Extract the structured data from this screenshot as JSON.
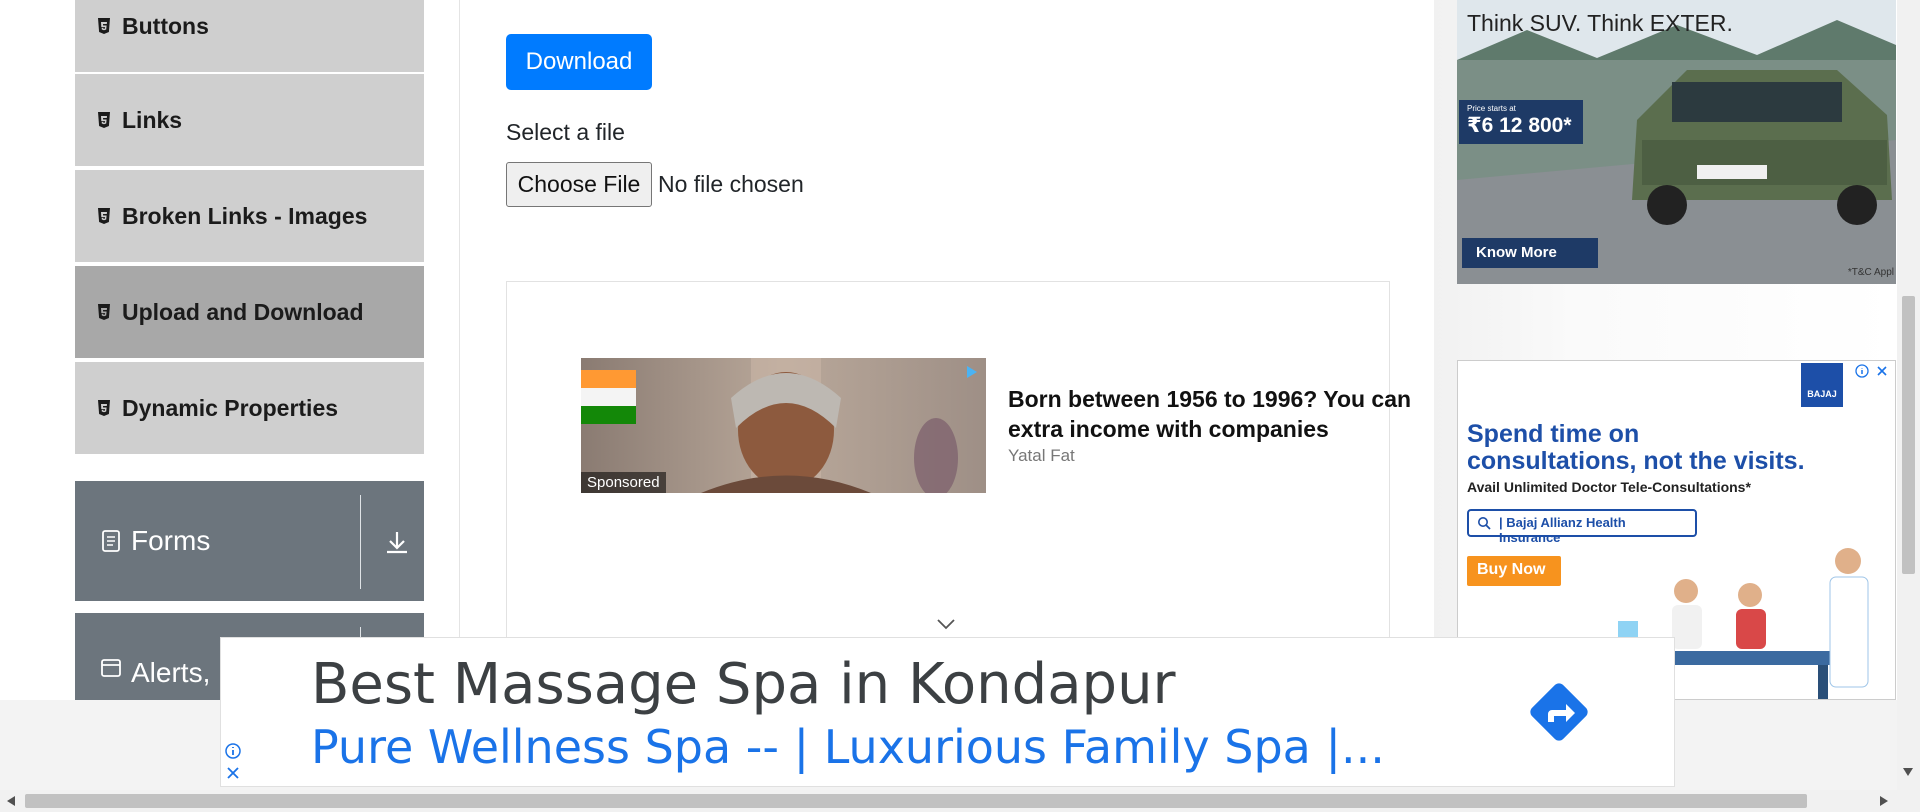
{
  "sidebar": {
    "items": [
      {
        "label": "Buttons",
        "icon": "html5-icon"
      },
      {
        "label": "Links",
        "icon": "html5-icon"
      },
      {
        "label": "Broken Links - Images",
        "icon": "html5-icon"
      },
      {
        "label": "Upload and Download",
        "icon": "html5-icon",
        "active": true
      },
      {
        "label": "Dynamic Properties",
        "icon": "html5-icon"
      }
    ],
    "groups": [
      {
        "label": "Forms",
        "icon": "form-icon"
      },
      {
        "label": "Alerts,",
        "icon": "window-icon"
      }
    ]
  },
  "main": {
    "download_label": "Download",
    "select_label": "Select a file",
    "choose_file_label": "Choose File",
    "no_file_text": "No file chosen"
  },
  "native_ad": {
    "sponsored": "Sponsored",
    "headline": "Born between 1956 to 1996? You can extra income with companies",
    "source": "Yatal Fat"
  },
  "car_ad": {
    "tagline": "Think SUV. Think EXTER.",
    "price_note": "Price starts at",
    "price": "₹6 12 800*",
    "cta": "Know More",
    "tc": "*T&C Appl"
  },
  "bajaj_ad": {
    "logo": "BAJAJ",
    "headline": "Spend time on consultations, not the visits.",
    "sub": "Avail Unlimited Doctor Tele-Consultations*",
    "search_text": "| Bajaj Allianz Health Insurance",
    "cta": "Buy Now"
  },
  "banner_ad": {
    "title": "Best Massage Spa in Kondapur",
    "subtitle": "Pure Wellness Spa -- | Luxurious Family Spa |..."
  },
  "colors": {
    "primary": "#007bff",
    "menu_bg": "#cfcfcf",
    "menu_active": "#a8a8a8",
    "group_bg": "#6c757d",
    "ad_link": "#1a73e8"
  }
}
